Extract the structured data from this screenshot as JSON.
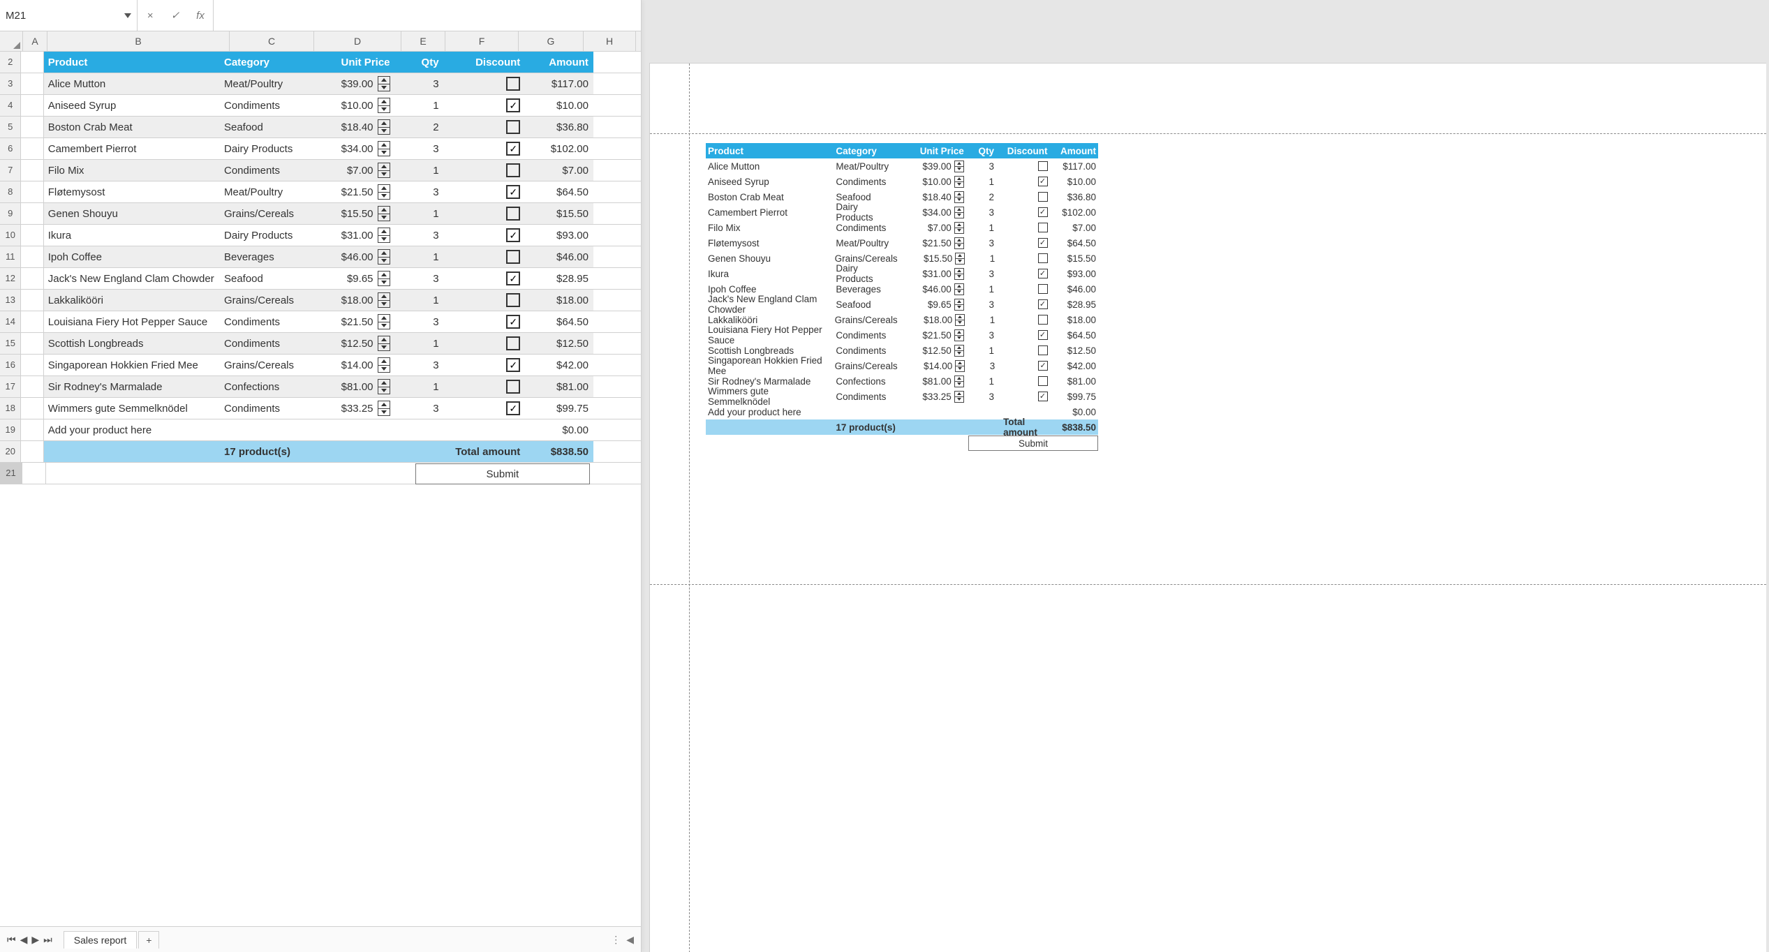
{
  "formula": {
    "name_box": "M21",
    "fx_label": "fx",
    "cancel": "×",
    "confirm": "✓",
    "value": ""
  },
  "columns": {
    "letters": [
      "A",
      "B",
      "C",
      "D",
      "E",
      "F",
      "G",
      "H"
    ]
  },
  "first_row_num": 2,
  "headers": {
    "product": "Product",
    "category": "Category",
    "unit_price": "Unit Price",
    "qty": "Qty",
    "discount": "Discount",
    "amount": "Amount"
  },
  "rows": [
    {
      "product": "Alice Mutton",
      "category": "Meat/Poultry",
      "price": "$39.00",
      "qty": "3",
      "discount": false,
      "amount": "$117.00"
    },
    {
      "product": "Aniseed Syrup",
      "category": "Condiments",
      "price": "$10.00",
      "qty": "1",
      "discount": true,
      "amount": "$10.00"
    },
    {
      "product": "Boston Crab Meat",
      "category": "Seafood",
      "price": "$18.40",
      "qty": "2",
      "discount": false,
      "amount": "$36.80"
    },
    {
      "product": "Camembert Pierrot",
      "category": "Dairy Products",
      "price": "$34.00",
      "qty": "3",
      "discount": true,
      "amount": "$102.00"
    },
    {
      "product": "Filo Mix",
      "category": "Condiments",
      "price": "$7.00",
      "qty": "1",
      "discount": false,
      "amount": "$7.00"
    },
    {
      "product": "Fløtemysost",
      "category": "Meat/Poultry",
      "price": "$21.50",
      "qty": "3",
      "discount": true,
      "amount": "$64.50"
    },
    {
      "product": "Genen Shouyu",
      "category": "Grains/Cereals",
      "price": "$15.50",
      "qty": "1",
      "discount": false,
      "amount": "$15.50"
    },
    {
      "product": "Ikura",
      "category": "Dairy Products",
      "price": "$31.00",
      "qty": "3",
      "discount": true,
      "amount": "$93.00"
    },
    {
      "product": "Ipoh Coffee",
      "category": "Beverages",
      "price": "$46.00",
      "qty": "1",
      "discount": false,
      "amount": "$46.00"
    },
    {
      "product": "Jack's New England Clam Chowder",
      "category": "Seafood",
      "price": "$9.65",
      "qty": "3",
      "discount": true,
      "amount": "$28.95"
    },
    {
      "product": "Lakkalikööri",
      "category": "Grains/Cereals",
      "price": "$18.00",
      "qty": "1",
      "discount": false,
      "amount": "$18.00"
    },
    {
      "product": "Louisiana Fiery Hot Pepper Sauce",
      "category": "Condiments",
      "price": "$21.50",
      "qty": "3",
      "discount": true,
      "amount": "$64.50"
    },
    {
      "product": "Scottish Longbreads",
      "category": "Condiments",
      "price": "$12.50",
      "qty": "1",
      "discount": false,
      "amount": "$12.50"
    },
    {
      "product": "Singaporean Hokkien Fried Mee",
      "category": "Grains/Cereals",
      "price": "$14.00",
      "qty": "3",
      "discount": true,
      "amount": "$42.00"
    },
    {
      "product": "Sir Rodney's Marmalade",
      "category": "Confections",
      "price": "$81.00",
      "qty": "1",
      "discount": false,
      "amount": "$81.00"
    },
    {
      "product": "Wimmers gute Semmelknödel",
      "category": "Condiments",
      "price": "$33.25",
      "qty": "3",
      "discount": true,
      "amount": "$99.75"
    }
  ],
  "filler": {
    "product": "Add your product here",
    "amount": "$0.00"
  },
  "summary": {
    "count": "17 product(s)",
    "total_label": "Total amount",
    "total": "$838.50",
    "submit": "Submit"
  },
  "tabs": {
    "sheet": "Sales report",
    "add": "+"
  },
  "nav": {
    "first": "⏮",
    "prev": "◀",
    "next": "▶",
    "last": "⏭"
  }
}
